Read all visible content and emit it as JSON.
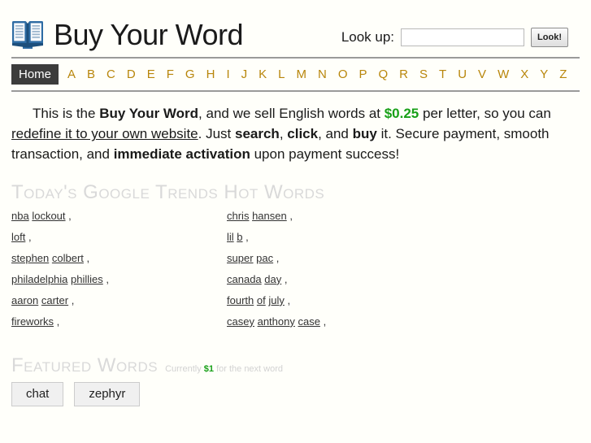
{
  "header": {
    "logo_icon": "open-book-icon",
    "title": "Buy Your Word",
    "lookup_label": "Look up:",
    "lookup_value": "",
    "lookup_placeholder": "",
    "lookup_button": "Look!"
  },
  "nav": {
    "home_label": "Home",
    "letters": [
      "A",
      "B",
      "C",
      "D",
      "E",
      "F",
      "G",
      "H",
      "I",
      "J",
      "K",
      "L",
      "M",
      "N",
      "O",
      "P",
      "Q",
      "R",
      "S",
      "T",
      "U",
      "V",
      "W",
      "X",
      "Y",
      "Z"
    ]
  },
  "intro": {
    "lead": "This is the ",
    "brand": "Buy Your Word",
    "mid1": ", and we sell English words at ",
    "price": "$0.25",
    "mid2": " per letter, so you can ",
    "redefine_link": "redefine it to your own website",
    "mid3": ". Just ",
    "search": "search",
    "mid4": ", ",
    "click": "click",
    "mid5": ", and ",
    "buy": "buy",
    "mid6": " it. Secure payment, smooth transaction, and ",
    "activation": "immediate activation",
    "tail": " upon payment success!"
  },
  "trends": {
    "heading": "Today's Google Trends Hot Words",
    "left_column": [
      {
        "words": [
          "nba",
          "lockout"
        ],
        "sep": ","
      },
      {
        "words": [
          "loft"
        ],
        "sep": ","
      },
      {
        "words": [
          "stephen",
          "colbert"
        ],
        "sep": ","
      },
      {
        "words": [
          "philadelphia",
          "phillies"
        ],
        "sep": ","
      },
      {
        "words": [
          "aaron",
          "carter"
        ],
        "sep": ","
      },
      {
        "words": [
          "fireworks"
        ],
        "sep": ","
      }
    ],
    "right_column": [
      {
        "words": [
          "chris",
          "hansen"
        ],
        "sep": ","
      },
      {
        "words": [
          "lil",
          "b"
        ],
        "sep": ","
      },
      {
        "words": [
          "super",
          "pac"
        ],
        "sep": ","
      },
      {
        "words": [
          "canada",
          "day"
        ],
        "sep": ","
      },
      {
        "words": [
          "fourth",
          "of",
          "july"
        ],
        "sep": ","
      },
      {
        "words": [
          "casey",
          "anthony",
          "case"
        ],
        "sep": ","
      }
    ]
  },
  "featured": {
    "heading": "Featured Words",
    "sub_prefix": "Currently ",
    "sub_price": "$1",
    "sub_suffix": " for the next word",
    "words": [
      "chat",
      "zephyr"
    ]
  },
  "colors": {
    "background": "#fffffa",
    "nav_letter": "#b8860b",
    "home_badge_bg": "#3c3c3c",
    "price_green": "#18a018",
    "heading_gray": "#d9d9d9",
    "rule_gray": "#9a9a9a"
  }
}
